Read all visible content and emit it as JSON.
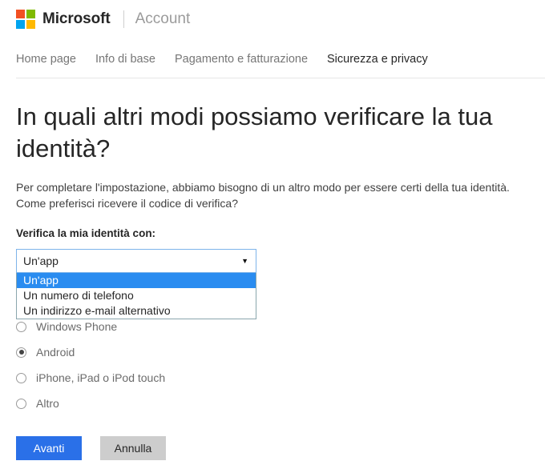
{
  "header": {
    "logo_icon": "microsoft-logo-icon",
    "logo_tiles": [
      "#f25022",
      "#7fba00",
      "#00a4ef",
      "#ffb900"
    ],
    "brand": "Microsoft",
    "sub_brand": "Account"
  },
  "nav": {
    "items": [
      {
        "label": "Home page",
        "active": false
      },
      {
        "label": "Info di base",
        "active": false
      },
      {
        "label": "Pagamento e fatturazione",
        "active": false
      },
      {
        "label": "Sicurezza e privacy",
        "active": true
      }
    ]
  },
  "main": {
    "title": "In quali altri modi possiamo verificare la tua identità?",
    "intro": "Per completare l'impostazione, abbiamo bisogno di un altro modo per essere certi della tua identità. Come preferisci ricevere il codice di verifica?",
    "field_label": "Verifica la mia identità con:",
    "select": {
      "value": "Un'app",
      "arrow_icon": "chevron-down-icon",
      "expanded": true,
      "options": [
        {
          "label": "Un'app",
          "selected": true
        },
        {
          "label": "Un numero di telefono",
          "selected": false
        },
        {
          "label": "Un indirizzo e-mail alternativo",
          "selected": false
        }
      ]
    },
    "radios": [
      {
        "label": "Windows Phone",
        "checked": false
      },
      {
        "label": "Android",
        "checked": true
      },
      {
        "label": "iPhone, iPad o iPod touch",
        "checked": false
      },
      {
        "label": "Altro",
        "checked": false
      }
    ],
    "buttons": {
      "primary": "Avanti",
      "secondary": "Annulla"
    }
  },
  "colors": {
    "accent": "#2a70e8",
    "highlight": "#2a8cf0",
    "focus_border": "#7eb4ea",
    "secondary_button": "#cdcdcd"
  }
}
